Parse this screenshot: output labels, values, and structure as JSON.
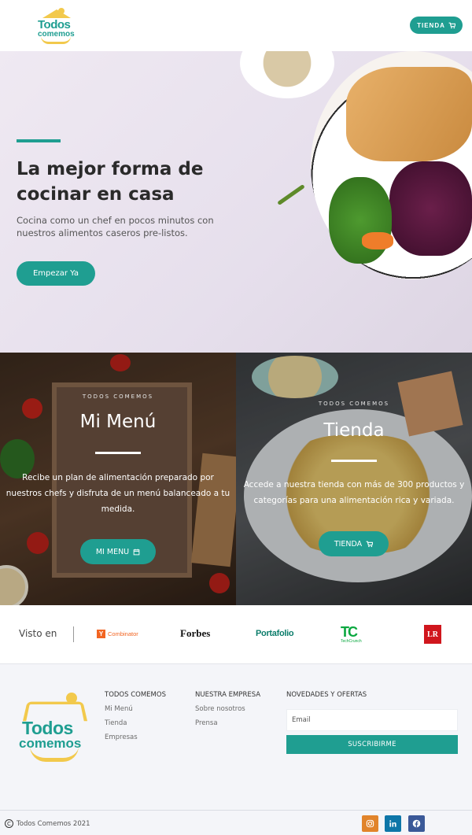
{
  "header": {
    "logo_line1": "Todos",
    "logo_line2": "comemos",
    "tienda_label": "TIENDA"
  },
  "hero": {
    "title": "La mejor forma de cocinar en casa",
    "subtitle": "Cocina como un chef en pocos minutos con nuestros alimentos caseros pre-listos.",
    "cta_label": "Empezar Ya"
  },
  "cards": {
    "menu": {
      "kicker": "TODOS COMEMOS",
      "title": "Mi Menú",
      "text": "Recibe un plan de alimentación preparado por nuestros chefs y disfruta de un menú balanceado a tu medida.",
      "button_label": "MI MENU"
    },
    "tienda": {
      "kicker": "TODOS COMEMOS",
      "title": "Tienda",
      "text": "Accede a nuestra tienda con más de 300 productos y categorías para una alimentación rica y variada.",
      "button_label": "TIENDA"
    }
  },
  "press": {
    "label": "Visto en",
    "ycombinator": "Combinator",
    "ycombinator_mark": "Y",
    "forbes": "Forbes",
    "portafolio": "Portafolio",
    "techcrunch_mark": "TC",
    "techcrunch_name": "TechCrunch",
    "lr": "LR"
  },
  "footer": {
    "logo_line1": "Todos",
    "logo_line2": "comemos",
    "col1": {
      "heading": "TODOS COMEMOS",
      "links": [
        "Mi Menú",
        "Tienda",
        "Empresas"
      ]
    },
    "col2": {
      "heading": "NUESTRA EMPRESA",
      "links": [
        "Sobre nosotros",
        "Prensa"
      ]
    },
    "col3": {
      "heading": "NOVEDADES Y OFERTAS",
      "email_placeholder": "Email",
      "subscribe_label": "SUSCRIBIRME"
    },
    "copyright": "Todos Comemos 2021",
    "copyright_symbol": "C",
    "social": [
      {
        "name": "instagram-icon",
        "color": "#e1842b"
      },
      {
        "name": "linkedin-icon",
        "color": "#0e76a8"
      },
      {
        "name": "facebook-icon",
        "color": "#3b5998"
      }
    ]
  },
  "colors": {
    "accent": "#1f9e91",
    "logo_yellow": "#f2c94c"
  }
}
